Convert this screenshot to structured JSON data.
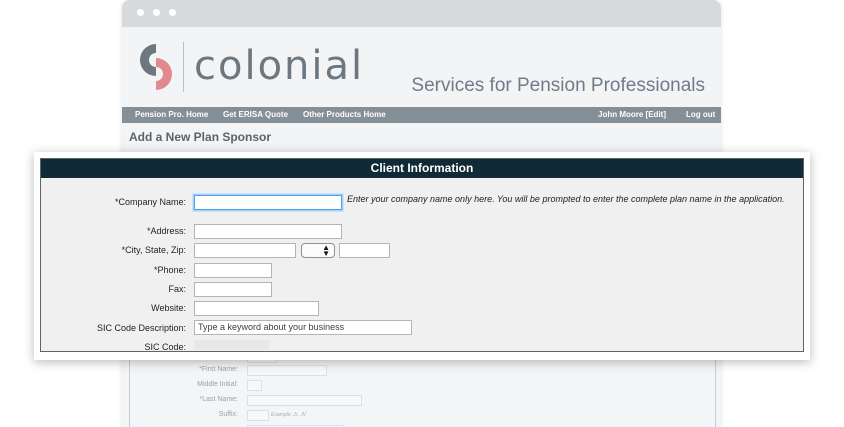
{
  "brand": {
    "name": "colonial",
    "tagline": "Services for Pension Professionals",
    "colors": {
      "red": "#e0898f",
      "gray": "#6d7780",
      "nav": "#848f98",
      "header": "#102a36"
    }
  },
  "nav": {
    "left": [
      "Pension Pro. Home",
      "Get ERISA Quote",
      "Other Products Home"
    ],
    "user": "John Moore [Edit]",
    "logout": "Log out"
  },
  "page": {
    "title": "Add a New Plan Sponsor"
  },
  "dialog": {
    "title": "Client Information",
    "fields": {
      "company_name": {
        "label": "*Company Name:",
        "value": "",
        "hint": "Enter your company name only here. You will be prompted to enter the complete plan name in the application."
      },
      "address": {
        "label": "*Address:",
        "value": ""
      },
      "city_state_zip": {
        "label": "*City, State, Zip:",
        "city": "",
        "state": "",
        "zip": ""
      },
      "phone": {
        "label": "*Phone:",
        "value": ""
      },
      "fax": {
        "label": "Fax:",
        "value": ""
      },
      "website": {
        "label": "Website:",
        "value": ""
      },
      "sic_description": {
        "label": "SIC Code Description:",
        "placeholder": "Type a keyword about your business"
      },
      "sic_code": {
        "label": "SIC Code:",
        "value": ""
      }
    }
  },
  "background_form": {
    "first_name": "*First Name:",
    "middle_initial": "Middle Initial:",
    "last_name": "*Last Name:",
    "suffix": "Suffix:",
    "suffix_hint": "Example: Jr., IV"
  }
}
